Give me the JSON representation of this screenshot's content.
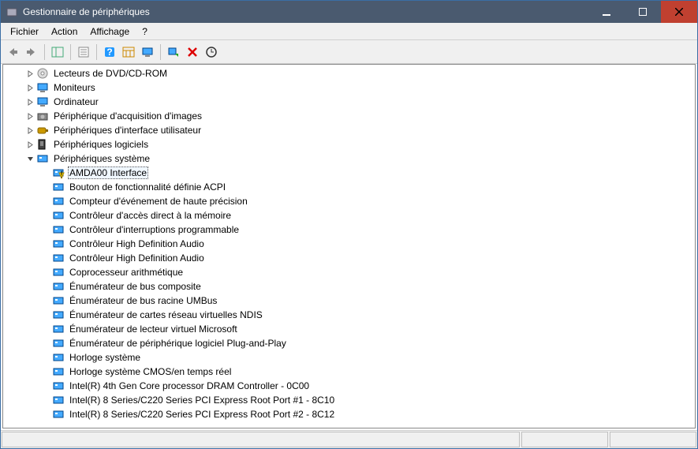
{
  "window": {
    "title": "Gestionnaire de périphériques"
  },
  "menu": {
    "file": "Fichier",
    "action": "Action",
    "view": "Affichage",
    "help": "?"
  },
  "tree": {
    "categories": [
      {
        "label": "Lecteurs de DVD/CD-ROM",
        "icon": "disc",
        "expanded": false
      },
      {
        "label": "Moniteurs",
        "icon": "monitor",
        "expanded": false
      },
      {
        "label": "Ordinateur",
        "icon": "monitor",
        "expanded": false
      },
      {
        "label": "Périphérique d'acquisition d'images",
        "icon": "camera",
        "expanded": false
      },
      {
        "label": "Périphériques d'interface utilisateur",
        "icon": "hid",
        "expanded": false
      },
      {
        "label": "Périphériques logiciels",
        "icon": "software",
        "expanded": false
      },
      {
        "label": "Périphériques système",
        "icon": "system",
        "expanded": true
      }
    ],
    "system_children": [
      {
        "label": "AMDA00 Interface",
        "selected": true,
        "warning": true
      },
      {
        "label": "Bouton de fonctionnalité définie ACPI"
      },
      {
        "label": "Compteur d'événement de haute précision"
      },
      {
        "label": "Contrôleur d'accès direct à la mémoire"
      },
      {
        "label": "Contrôleur d'interruptions programmable"
      },
      {
        "label": "Contrôleur High Definition Audio"
      },
      {
        "label": "Contrôleur High Definition Audio"
      },
      {
        "label": "Coprocesseur arithmétique"
      },
      {
        "label": "Énumérateur de bus composite"
      },
      {
        "label": "Énumérateur de bus racine UMBus"
      },
      {
        "label": "Énumérateur de cartes réseau virtuelles NDIS"
      },
      {
        "label": "Énumérateur de lecteur virtuel Microsoft"
      },
      {
        "label": "Énumérateur de périphérique logiciel Plug-and-Play"
      },
      {
        "label": "Horloge système"
      },
      {
        "label": "Horloge système CMOS/en temps réel"
      },
      {
        "label": "Intel(R) 4th Gen Core processor DRAM Controller - 0C00"
      },
      {
        "label": "Intel(R) 8 Series/C220 Series PCI Express Root Port #1 - 8C10"
      },
      {
        "label": "Intel(R) 8 Series/C220 Series PCI Express Root Port #2 - 8C12"
      }
    ]
  },
  "toolbar": {
    "back": "back-icon",
    "forward": "forward-icon",
    "show_hide": "show-hide-tree-icon",
    "properties": "properties-icon",
    "help": "help-icon",
    "details": "details-icon",
    "monitor": "monitor-icon",
    "scan": "scan-hardware-icon",
    "delete": "delete-icon",
    "update": "update-driver-icon"
  }
}
